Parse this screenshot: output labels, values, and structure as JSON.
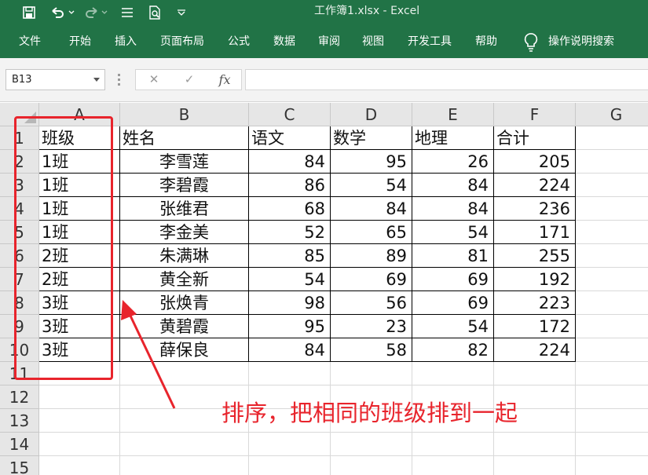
{
  "window": {
    "title": "工作簿1.xlsx  -  Excel"
  },
  "quick_access": [
    "save-icon",
    "undo-icon",
    "redo-icon",
    "form-icon",
    "print-preview-icon",
    "customize-icon"
  ],
  "ribbon": {
    "tabs": [
      "文件",
      "开始",
      "插入",
      "页面布局",
      "公式",
      "数据",
      "审阅",
      "视图",
      "开发工具",
      "帮助"
    ],
    "tell_me": "操作说明搜索"
  },
  "formula_bar": {
    "name_box": "B13",
    "cancel": "✕",
    "enter": "✓",
    "fx": "fx",
    "formula": ""
  },
  "sheet": {
    "columns": [
      "A",
      "B",
      "C",
      "D",
      "E",
      "F",
      "G"
    ],
    "rows": [
      "1",
      "2",
      "3",
      "4",
      "5",
      "6",
      "7",
      "8",
      "9",
      "10",
      "11",
      "12",
      "13",
      "14",
      "15"
    ],
    "header": [
      "班级",
      "姓名",
      "语文",
      "数学",
      "地理",
      "合计"
    ],
    "data": [
      [
        "1班",
        "李雪莲",
        "84",
        "95",
        "26",
        "205"
      ],
      [
        "1班",
        "李碧霞",
        "86",
        "54",
        "84",
        "224"
      ],
      [
        "1班",
        "张维君",
        "68",
        "84",
        "84",
        "236"
      ],
      [
        "1班",
        "李金美",
        "52",
        "65",
        "54",
        "171"
      ],
      [
        "2班",
        "朱满琳",
        "85",
        "89",
        "81",
        "255"
      ],
      [
        "2班",
        "黄全新",
        "54",
        "69",
        "69",
        "192"
      ],
      [
        "3班",
        "张焕青",
        "98",
        "56",
        "69",
        "223"
      ],
      [
        "3班",
        "黄碧霞",
        "95",
        "23",
        "54",
        "172"
      ],
      [
        "3班",
        "薛保良",
        "84",
        "58",
        "82",
        "224"
      ]
    ]
  },
  "annotation": {
    "text": "排序，把相同的班级排到一起"
  },
  "colors": {
    "excel_green": "#217346",
    "annotation_red": "#e8242c"
  }
}
